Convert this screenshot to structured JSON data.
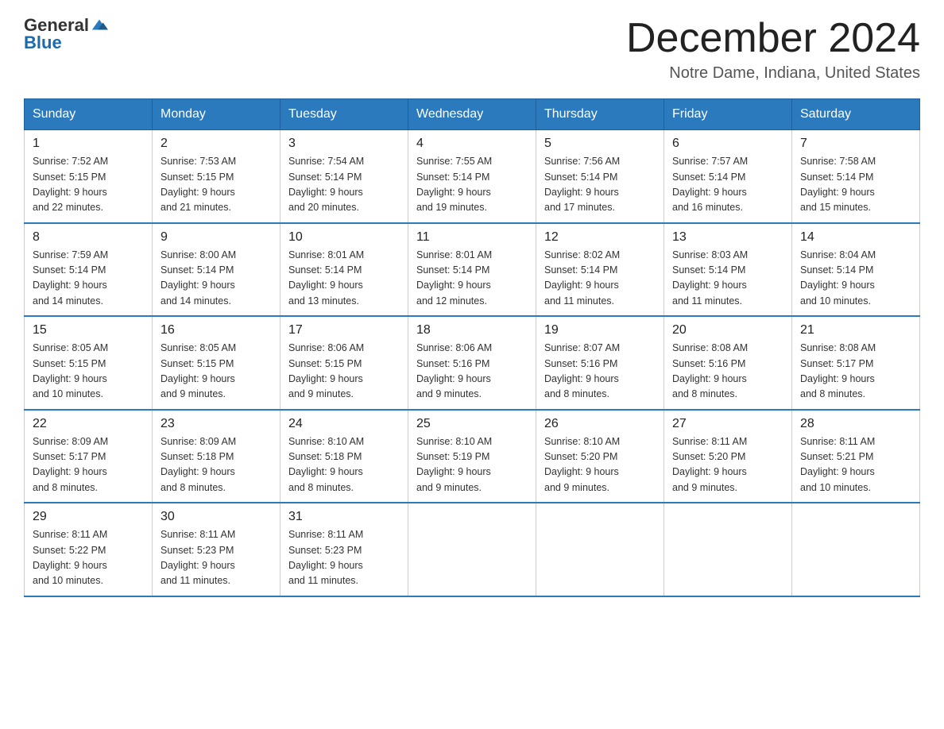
{
  "header": {
    "logo_general": "General",
    "logo_blue": "Blue",
    "title": "December 2024",
    "subtitle": "Notre Dame, Indiana, United States"
  },
  "days_of_week": [
    "Sunday",
    "Monday",
    "Tuesday",
    "Wednesday",
    "Thursday",
    "Friday",
    "Saturday"
  ],
  "weeks": [
    [
      {
        "day": "1",
        "sunrise": "7:52 AM",
        "sunset": "5:15 PM",
        "daylight": "9 hours and 22 minutes."
      },
      {
        "day": "2",
        "sunrise": "7:53 AM",
        "sunset": "5:15 PM",
        "daylight": "9 hours and 21 minutes."
      },
      {
        "day": "3",
        "sunrise": "7:54 AM",
        "sunset": "5:14 PM",
        "daylight": "9 hours and 20 minutes."
      },
      {
        "day": "4",
        "sunrise": "7:55 AM",
        "sunset": "5:14 PM",
        "daylight": "9 hours and 19 minutes."
      },
      {
        "day": "5",
        "sunrise": "7:56 AM",
        "sunset": "5:14 PM",
        "daylight": "9 hours and 17 minutes."
      },
      {
        "day": "6",
        "sunrise": "7:57 AM",
        "sunset": "5:14 PM",
        "daylight": "9 hours and 16 minutes."
      },
      {
        "day": "7",
        "sunrise": "7:58 AM",
        "sunset": "5:14 PM",
        "daylight": "9 hours and 15 minutes."
      }
    ],
    [
      {
        "day": "8",
        "sunrise": "7:59 AM",
        "sunset": "5:14 PM",
        "daylight": "9 hours and 14 minutes."
      },
      {
        "day": "9",
        "sunrise": "8:00 AM",
        "sunset": "5:14 PM",
        "daylight": "9 hours and 14 minutes."
      },
      {
        "day": "10",
        "sunrise": "8:01 AM",
        "sunset": "5:14 PM",
        "daylight": "9 hours and 13 minutes."
      },
      {
        "day": "11",
        "sunrise": "8:01 AM",
        "sunset": "5:14 PM",
        "daylight": "9 hours and 12 minutes."
      },
      {
        "day": "12",
        "sunrise": "8:02 AM",
        "sunset": "5:14 PM",
        "daylight": "9 hours and 11 minutes."
      },
      {
        "day": "13",
        "sunrise": "8:03 AM",
        "sunset": "5:14 PM",
        "daylight": "9 hours and 11 minutes."
      },
      {
        "day": "14",
        "sunrise": "8:04 AM",
        "sunset": "5:14 PM",
        "daylight": "9 hours and 10 minutes."
      }
    ],
    [
      {
        "day": "15",
        "sunrise": "8:05 AM",
        "sunset": "5:15 PM",
        "daylight": "9 hours and 10 minutes."
      },
      {
        "day": "16",
        "sunrise": "8:05 AM",
        "sunset": "5:15 PM",
        "daylight": "9 hours and 9 minutes."
      },
      {
        "day": "17",
        "sunrise": "8:06 AM",
        "sunset": "5:15 PM",
        "daylight": "9 hours and 9 minutes."
      },
      {
        "day": "18",
        "sunrise": "8:06 AM",
        "sunset": "5:16 PM",
        "daylight": "9 hours and 9 minutes."
      },
      {
        "day": "19",
        "sunrise": "8:07 AM",
        "sunset": "5:16 PM",
        "daylight": "9 hours and 8 minutes."
      },
      {
        "day": "20",
        "sunrise": "8:08 AM",
        "sunset": "5:16 PM",
        "daylight": "9 hours and 8 minutes."
      },
      {
        "day": "21",
        "sunrise": "8:08 AM",
        "sunset": "5:17 PM",
        "daylight": "9 hours and 8 minutes."
      }
    ],
    [
      {
        "day": "22",
        "sunrise": "8:09 AM",
        "sunset": "5:17 PM",
        "daylight": "9 hours and 8 minutes."
      },
      {
        "day": "23",
        "sunrise": "8:09 AM",
        "sunset": "5:18 PM",
        "daylight": "9 hours and 8 minutes."
      },
      {
        "day": "24",
        "sunrise": "8:10 AM",
        "sunset": "5:18 PM",
        "daylight": "9 hours and 8 minutes."
      },
      {
        "day": "25",
        "sunrise": "8:10 AM",
        "sunset": "5:19 PM",
        "daylight": "9 hours and 9 minutes."
      },
      {
        "day": "26",
        "sunrise": "8:10 AM",
        "sunset": "5:20 PM",
        "daylight": "9 hours and 9 minutes."
      },
      {
        "day": "27",
        "sunrise": "8:11 AM",
        "sunset": "5:20 PM",
        "daylight": "9 hours and 9 minutes."
      },
      {
        "day": "28",
        "sunrise": "8:11 AM",
        "sunset": "5:21 PM",
        "daylight": "9 hours and 10 minutes."
      }
    ],
    [
      {
        "day": "29",
        "sunrise": "8:11 AM",
        "sunset": "5:22 PM",
        "daylight": "9 hours and 10 minutes."
      },
      {
        "day": "30",
        "sunrise": "8:11 AM",
        "sunset": "5:23 PM",
        "daylight": "9 hours and 11 minutes."
      },
      {
        "day": "31",
        "sunrise": "8:11 AM",
        "sunset": "5:23 PM",
        "daylight": "9 hours and 11 minutes."
      },
      null,
      null,
      null,
      null
    ]
  ],
  "labels": {
    "sunrise": "Sunrise:",
    "sunset": "Sunset:",
    "daylight": "Daylight:"
  }
}
